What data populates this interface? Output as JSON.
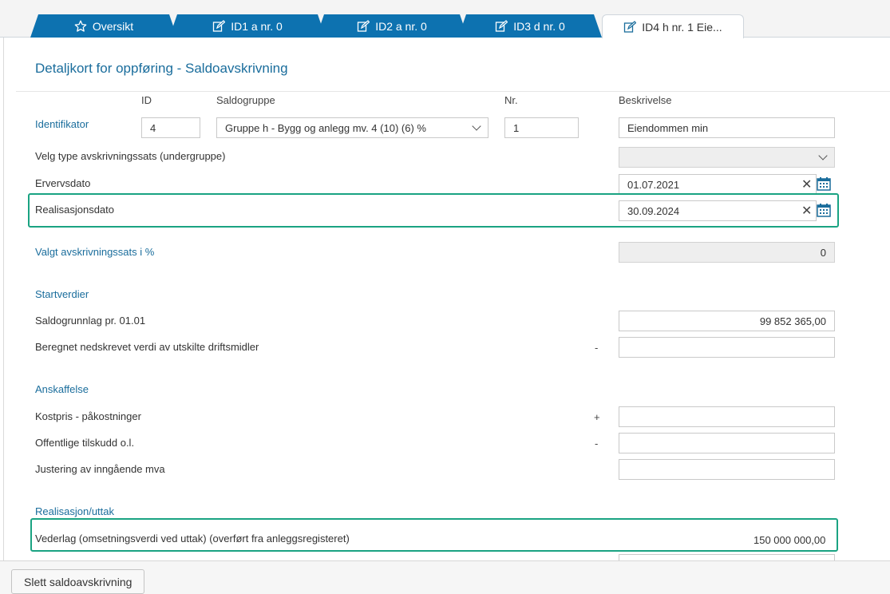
{
  "tabs": [
    {
      "label": "Oversikt",
      "icon": "star-icon"
    },
    {
      "label": "ID1 a nr. 0",
      "icon": "edit-icon"
    },
    {
      "label": "ID2 a nr. 0",
      "icon": "edit-icon"
    },
    {
      "label": "ID3 d nr. 0",
      "icon": "edit-icon"
    },
    {
      "label": "ID4 h nr. 1 Eie...",
      "icon": "edit-icon",
      "active": true
    }
  ],
  "page": {
    "title": "Detaljkort for oppføring - Saldoavskrivning"
  },
  "identifier": {
    "label": "Identifikator",
    "col_id": "ID",
    "col_group": "Saldogruppe",
    "col_nr": "Nr.",
    "col_desc": "Beskrivelse",
    "id_value": "4",
    "group_value": "Gruppe h - Bygg og anlegg mv. 4 (10) (6) %",
    "nr_value": "1",
    "desc_value": "Eiendommen min"
  },
  "rate_type": {
    "label": "Velg type avskrivningssats (undergruppe)",
    "value": ""
  },
  "acquisition_date": {
    "label": "Ervervsdato",
    "value": "01.07.2021"
  },
  "realization_date": {
    "label": "Realisasjonsdato",
    "value": "30.09.2024"
  },
  "selected_rate": {
    "label": "Valgt avskrivningssats i %",
    "value": "0"
  },
  "start_values": {
    "heading": "Startverdier",
    "balance_label": "Saldogrunnlag pr. 01.01",
    "balance_value": "99 852 365,00",
    "written_down_label": "Beregnet nedskrevet verdi av utskilte driftsmidler",
    "written_down_sign": "-",
    "written_down_value": ""
  },
  "acquisition": {
    "heading": "Anskaffelse",
    "cost_label": "Kostpris - påkostninger",
    "cost_sign": "+",
    "cost_value": "",
    "grants_label": "Offentlige tilskudd o.l.",
    "grants_sign": "-",
    "grants_value": "",
    "vat_label": "Justering av inngående mva",
    "vat_value": ""
  },
  "realization": {
    "heading": "Realisasjon/uttak",
    "consideration_label": "Vederlag (omsetningsverdi ved uttak) (overført fra anleggsregisteret)",
    "consideration_value": "150 000 000,00"
  },
  "footer": {
    "delete_button": "Slett saldoavskrivning"
  },
  "colors": {
    "tab_blue": "#0d72b0",
    "label_blue": "#1a6d9c",
    "highlight_green": "#1aa382"
  }
}
